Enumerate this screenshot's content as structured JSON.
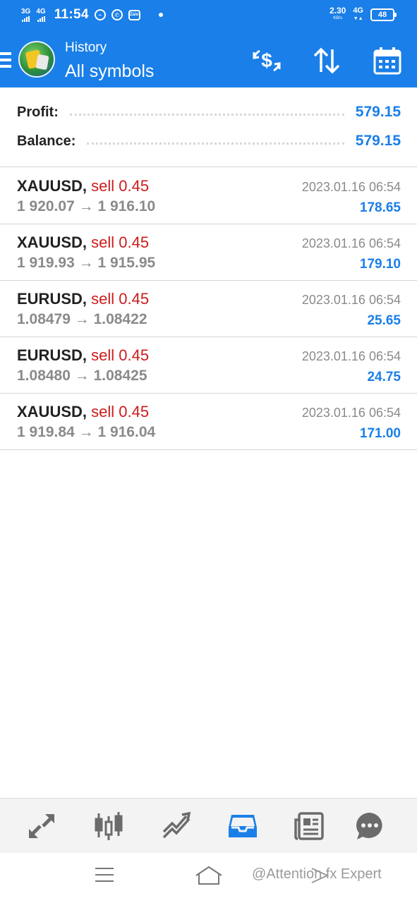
{
  "status_bar": {
    "net1": "3G",
    "net2": "4G",
    "time": "11:54",
    "speed_value": "2.30",
    "speed_unit": "KB/s",
    "net3": "4G",
    "battery": "48"
  },
  "header": {
    "subtitle": "History",
    "title": "All symbols",
    "icons": [
      "currency-exchange-icon",
      "sort-icon",
      "calendar-icon"
    ]
  },
  "summary": {
    "profit_label": "Profit:",
    "profit_value": "579.15",
    "balance_label": "Balance:",
    "balance_value": "579.15"
  },
  "deals": [
    {
      "symbol": "XAUUSD",
      "side": "sell 0.45",
      "open_price": "1 920.07",
      "close_price": "1 916.10",
      "time": "2023.01.16 06:54",
      "profit": "178.65"
    },
    {
      "symbol": "XAUUSD",
      "side": "sell 0.45",
      "open_price": "1 919.93",
      "close_price": "1 915.95",
      "time": "2023.01.16 06:54",
      "profit": "179.10"
    },
    {
      "symbol": "EURUSD",
      "side": "sell 0.45",
      "open_price": "1.08479",
      "close_price": "1.08422",
      "time": "2023.01.16 06:54",
      "profit": "25.65"
    },
    {
      "symbol": "EURUSD",
      "side": "sell 0.45",
      "open_price": "1.08480",
      "close_price": "1.08425",
      "time": "2023.01.16 06:54",
      "profit": "24.75"
    },
    {
      "symbol": "XAUUSD",
      "side": "sell 0.45",
      "open_price": "1 919.84",
      "close_price": "1 916.04",
      "time": "2023.01.16 06:54",
      "profit": "171.00"
    }
  ],
  "arrow": "→",
  "comma": ",",
  "bottom_nav": [
    "quotes-icon",
    "chart-icon",
    "trade-icon",
    "history-icon",
    "news-icon",
    "messages-icon"
  ],
  "watermark": "@Attention fx Expert",
  "colors": {
    "accent": "#1a7fe8",
    "sell": "#cc1c1c",
    "muted": "#8a8a8a"
  }
}
